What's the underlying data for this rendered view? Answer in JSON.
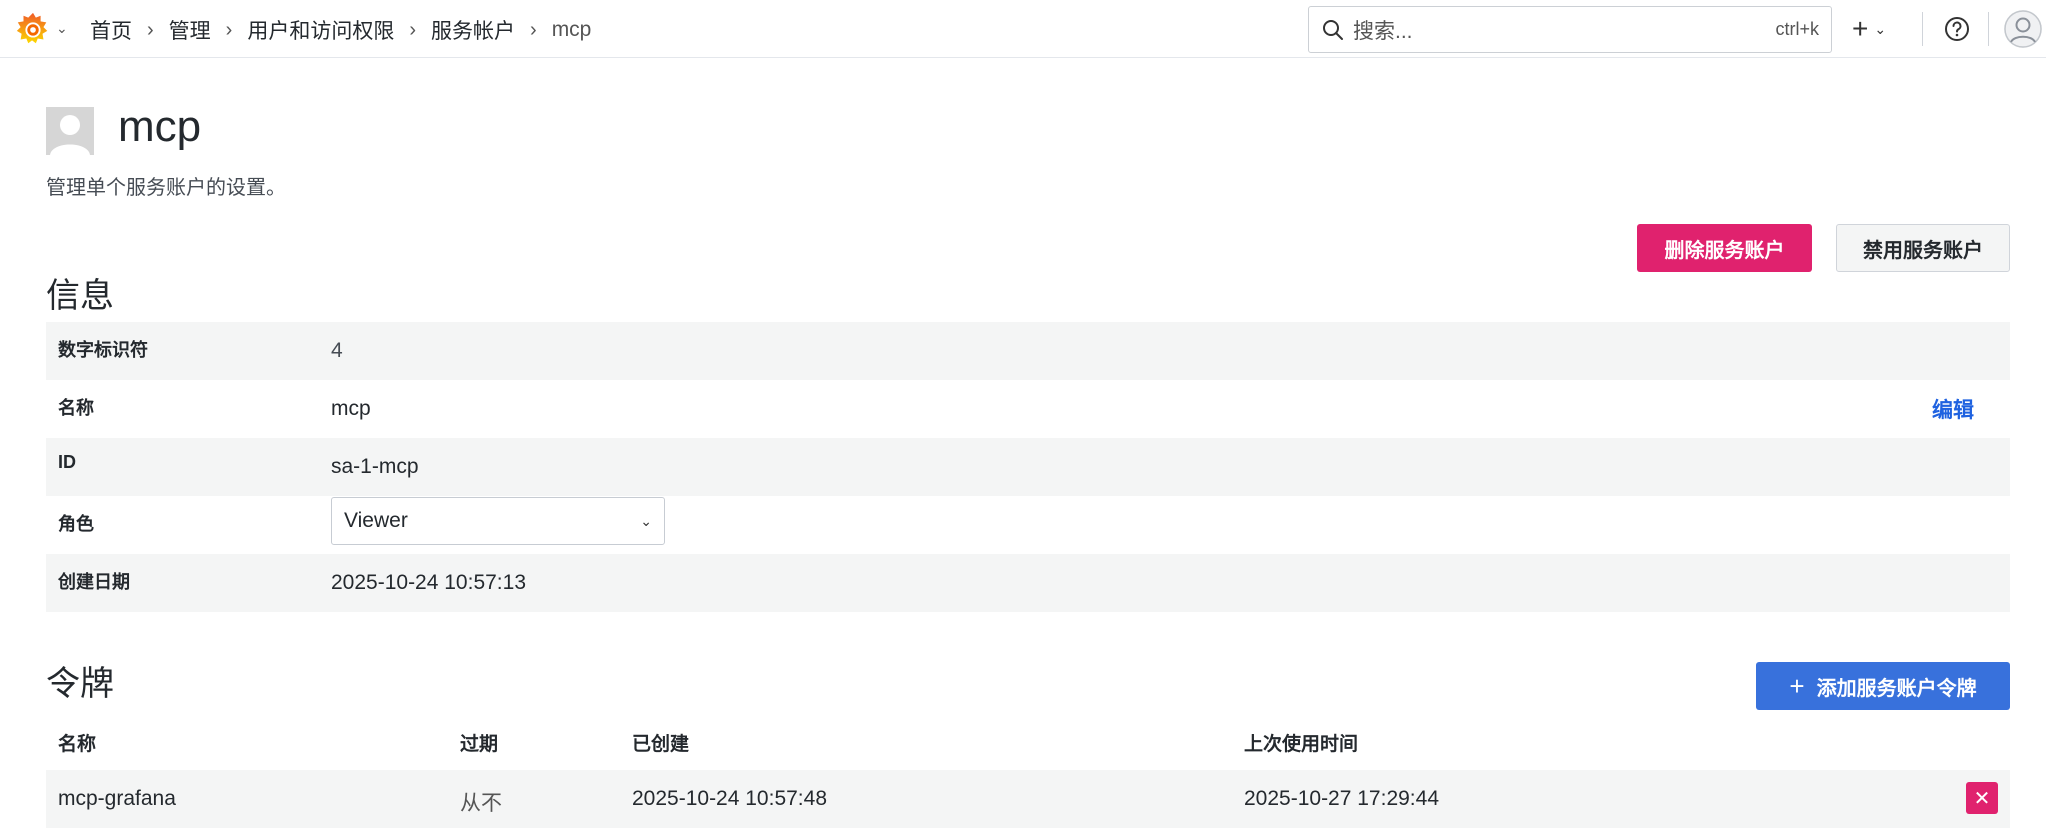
{
  "topbar": {
    "breadcrumb": [
      "首页",
      "管理",
      "用户和访问权限",
      "服务帐户",
      "mcp"
    ],
    "search_placeholder": "搜索...",
    "search_shortcut": "ctrl+k",
    "add_label": "+"
  },
  "header": {
    "title": "mcp",
    "subtitle": "管理单个服务账户的设置。",
    "delete_button": "删除服务账户",
    "disable_button": "禁用服务账户"
  },
  "info": {
    "title": "信息",
    "rows": [
      {
        "key": "数字标识符",
        "value": "4"
      },
      {
        "key": "名称",
        "value": "mcp",
        "action": "编辑"
      },
      {
        "key": "ID",
        "value": "sa-1-mcp"
      },
      {
        "key": "角色",
        "value": "Viewer"
      },
      {
        "key": "创建日期",
        "value": "2025-10-24 10:57:13"
      }
    ]
  },
  "tokens": {
    "title": "令牌",
    "add_button": "添加服务账户令牌",
    "columns": [
      "名称",
      "过期",
      "已创建",
      "上次使用时间"
    ],
    "rows": [
      {
        "name": "mcp-grafana",
        "expires": "从不",
        "created": "2025-10-24 10:57:48",
        "last_used": "2025-10-27 17:29:44"
      }
    ]
  },
  "colors": {
    "danger": "#e0226e",
    "primary": "#3871dc",
    "link": "#1f62e0",
    "brand_orange": "#f46800"
  }
}
